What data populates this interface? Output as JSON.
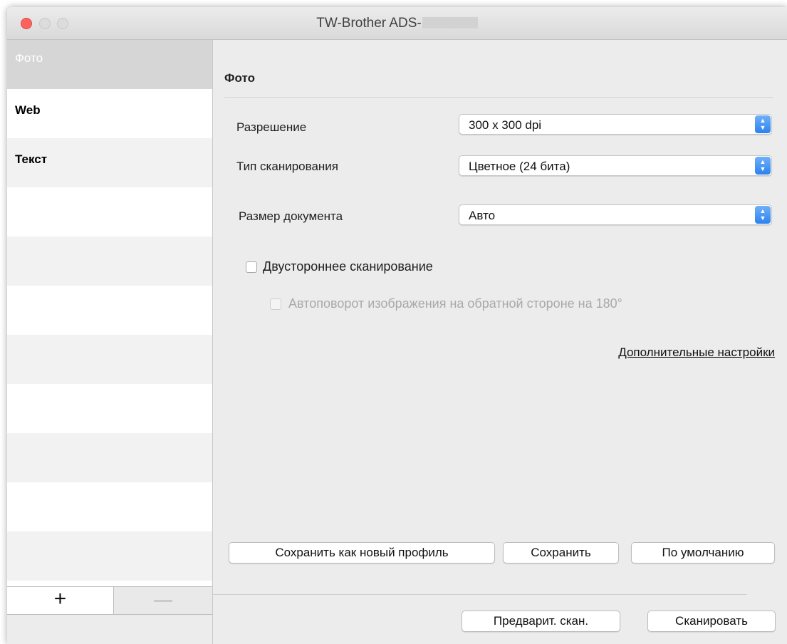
{
  "window": {
    "title": "TW-Brother ADS-"
  },
  "sidebar": {
    "items": [
      {
        "label": "Фото",
        "selected": true
      },
      {
        "label": "Web",
        "selected": false
      },
      {
        "label": "Текст",
        "selected": false
      }
    ],
    "add_label": "+",
    "remove_label": "—"
  },
  "panel": {
    "title": "Фото",
    "resolution": {
      "label": "Разрешение",
      "value": "300 x 300 dpi"
    },
    "scan_type": {
      "label": "Тип сканирования",
      "value": "Цветное (24 бита)"
    },
    "document_size": {
      "label": "Размер документа",
      "value": "Авто"
    },
    "duplex": {
      "label": "Двустороннее сканирование",
      "checked": false
    },
    "autorotate": {
      "label": "Автоповорот изображения на обратной стороне на 180°",
      "checked": false,
      "enabled": false
    },
    "advanced_link": "Дополнительные настройки",
    "save_as_new_label": "Сохранить как новый профиль",
    "save_label": "Сохранить",
    "default_label": "По умолчанию"
  },
  "footer": {
    "preview_label": "Предварит. скан.",
    "scan_label": "Сканировать"
  },
  "colors": {
    "close_button": "#fc615d",
    "popup_arrow": "#2b82ee",
    "selected_row": "#d6d6d6"
  }
}
